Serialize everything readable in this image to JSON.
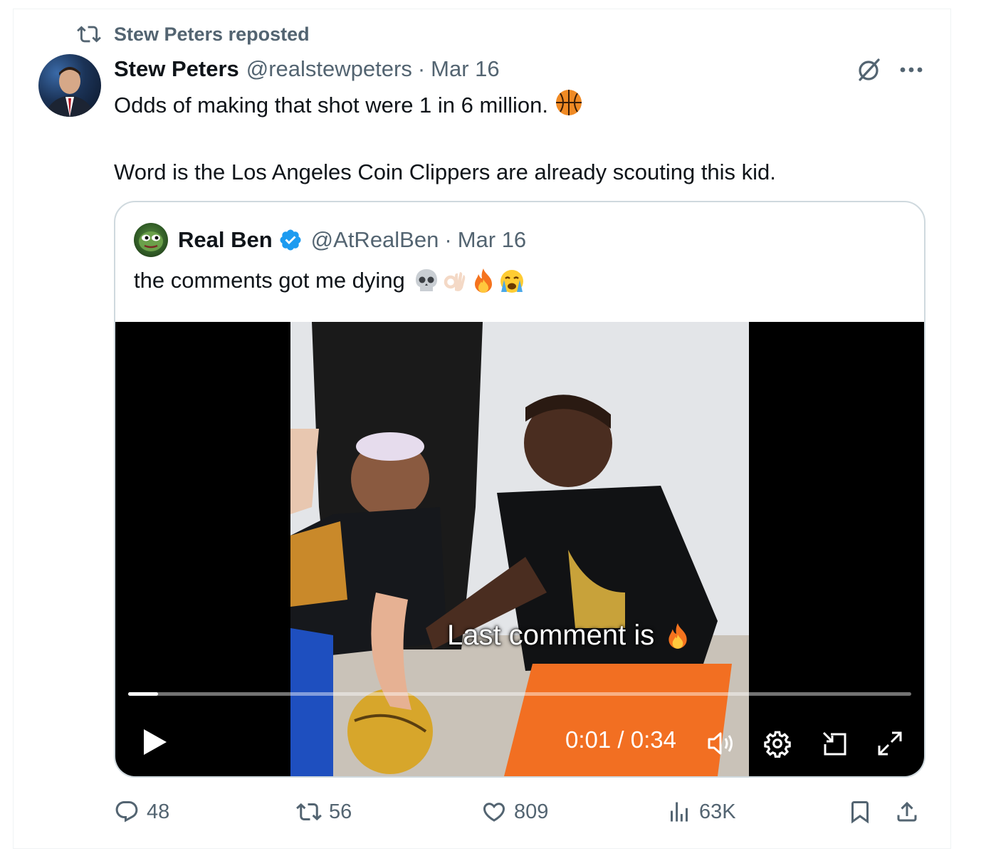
{
  "repost": {
    "icon": "retweet-icon",
    "label": "Stew Peters reposted"
  },
  "post": {
    "author_name": "Stew Peters",
    "author_handle": "@realstewpeters",
    "separator": "·",
    "date": "Mar 16",
    "line1": "Odds of making that shot were 1 in 6 million.",
    "line1_emoji": "basketball-emoji",
    "line2": "Word is the Los Angeles Coin Clippers are already scouting this kid."
  },
  "top_actions": {
    "grok_icon": "grok-icon",
    "more_icon": "more-icon"
  },
  "quote": {
    "author_name": "Real Ben",
    "verified": true,
    "author_handle": "@AtRealBen",
    "separator": "·",
    "date": "Mar 16",
    "text": "the comments got me dying",
    "text_emojis": [
      "skull-emoji",
      "ok-hand-emoji",
      "fire-emoji",
      "crying-emoji"
    ],
    "video": {
      "overlay_text": "Last comment is",
      "overlay_emoji": "fire-emoji",
      "current_time": "0:01",
      "time_separator": "/",
      "duration": "0:34",
      "progress_fraction": 0.038
    }
  },
  "actions": {
    "replies": "48",
    "reposts": "56",
    "likes": "809",
    "views": "63K"
  },
  "colors": {
    "text": "#0f1419",
    "secondary": "#536471",
    "border": "#cfd9de",
    "verified": "#1d9bf0"
  }
}
